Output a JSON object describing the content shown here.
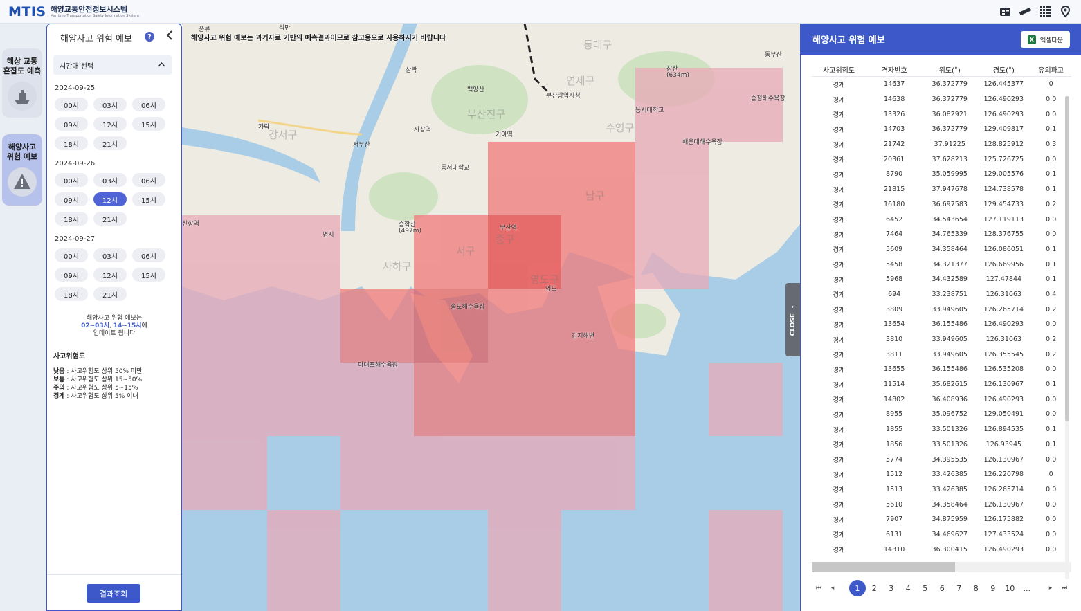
{
  "header": {
    "logo_mark": "MTIS",
    "logo_ko": "해양교통안전정보시스템",
    "logo_en": "Maritime Transportation Safety Information System",
    "icons": [
      "id-card-icon",
      "ruler-icon",
      "grid-icon",
      "location-pin-icon"
    ]
  },
  "rail": {
    "items": [
      {
        "label": "해상 교통\n혼잡도 예측",
        "icon": "ship-congestion-icon"
      },
      {
        "label": "해양사고\n위험 예보",
        "icon": "ship-warning-icon"
      }
    ]
  },
  "panel": {
    "title": "해양사고 위험 예보",
    "help": "?",
    "collapse": "<",
    "time_select_label": "시간대 선택",
    "dates": [
      {
        "date": "2024-09-25",
        "slots": [
          "00시",
          "03시",
          "06시",
          "09시",
          "12시",
          "15시",
          "18시",
          "21시"
        ]
      },
      {
        "date": "2024-09-26",
        "slots": [
          "00시",
          "03시",
          "06시",
          "09시",
          "12시",
          "15시",
          "18시",
          "21시"
        ]
      },
      {
        "date": "2024-09-27",
        "slots": [
          "00시",
          "03시",
          "06시",
          "09시",
          "12시",
          "15시",
          "18시",
          "21시"
        ]
      }
    ],
    "selected": {
      "date": "2024-09-26",
      "slot": "12시"
    },
    "note_line1": "해양사고 위험 예보는",
    "note_time1": "02~03시",
    "note_sep": ", ",
    "note_time2": "14~15시",
    "note_suffix": "에",
    "note_line3": "업데이트 됩니다",
    "legend_title": "사고위험도",
    "legend": [
      {
        "level": "낮음",
        "desc": " : 사고위험도 상위 50% 미만"
      },
      {
        "level": "보통",
        "desc": " : 사고위험도 상위 15~50%"
      },
      {
        "level": "주의",
        "desc": " : 사고위험도 상위 5~15%"
      },
      {
        "level": "경계",
        "desc": " : 사고위험도 상위 5% 이내"
      }
    ],
    "search_button": "결과조회"
  },
  "map": {
    "notice": "해양사고 위험 예보는 과거자료 기반의 예측결과이므로 참고용으로 사용하시기 바랍니다",
    "close_tab": "CLOSE",
    "labels": [
      "풍류",
      "식만",
      "강서구",
      "가락",
      "서부산",
      "삼락",
      "백양산",
      "부산진구",
      "사상역",
      "기아역",
      "동서대학교",
      "동래구",
      "부산광역시청",
      "연제구",
      "수영구",
      "동서대학교",
      "해운대해수욕장",
      "송정해수욕장",
      "장산",
      "(634m)",
      "동부산",
      "신항역",
      "명지",
      "승학산",
      "(497m)",
      "사하구",
      "서구",
      "중구",
      "부산역",
      "남구",
      "영도구",
      "영도",
      "송도해수욕장",
      "감지해변",
      "다대포해수욕장"
    ]
  },
  "result": {
    "title": "해양사고 위험 예보",
    "excel_button": "엑셀다운",
    "columns": [
      "사고위험도",
      "격자번호",
      "위도(˚)",
      "경도(˚)",
      "유의파고"
    ],
    "rows": [
      [
        "경계",
        "14637",
        "36.372779",
        "126.445377",
        "0"
      ],
      [
        "경계",
        "14638",
        "36.372779",
        "126.490293",
        "0.0"
      ],
      [
        "경계",
        "13326",
        "36.082921",
        "126.490293",
        "0.0"
      ],
      [
        "경계",
        "14703",
        "36.372779",
        "129.409817",
        "0.1"
      ],
      [
        "경계",
        "21742",
        "37.91225",
        "128.825912",
        "0.3"
      ],
      [
        "경계",
        "20361",
        "37.628213",
        "125.726725",
        "0.0"
      ],
      [
        "경계",
        "8790",
        "35.059995",
        "129.005576",
        "0.1"
      ],
      [
        "경계",
        "21815",
        "37.947678",
        "124.738578",
        "0.1"
      ],
      [
        "경계",
        "16180",
        "36.697583",
        "129.454733",
        "0.2"
      ],
      [
        "경계",
        "6452",
        "34.543654",
        "127.119113",
        "0.0"
      ],
      [
        "경계",
        "7464",
        "34.765339",
        "128.376755",
        "0.0"
      ],
      [
        "경계",
        "5609",
        "34.358464",
        "126.086051",
        "0.1"
      ],
      [
        "경계",
        "5458",
        "34.321377",
        "126.669956",
        "0.1"
      ],
      [
        "경계",
        "5968",
        "34.432589",
        "127.47844",
        "0.1"
      ],
      [
        "경계",
        "694",
        "33.238751",
        "126.31063",
        "0.4"
      ],
      [
        "경계",
        "3809",
        "33.949605",
        "126.265714",
        "0.2"
      ],
      [
        "경계",
        "13654",
        "36.155486",
        "126.490293",
        "0.0"
      ],
      [
        "경계",
        "3810",
        "33.949605",
        "126.31063",
        "0.2"
      ],
      [
        "경계",
        "3811",
        "33.949605",
        "126.355545",
        "0.2"
      ],
      [
        "경계",
        "13655",
        "36.155486",
        "126.535208",
        "0.0"
      ],
      [
        "경계",
        "11514",
        "35.682615",
        "126.130967",
        "0.1"
      ],
      [
        "경계",
        "14802",
        "36.408936",
        "126.490293",
        "0.0"
      ],
      [
        "경계",
        "8955",
        "35.096752",
        "129.050491",
        "0.0"
      ],
      [
        "경계",
        "1855",
        "33.501326",
        "126.894535",
        "0.1"
      ],
      [
        "경계",
        "1856",
        "33.501326",
        "126.93945",
        "0.1"
      ],
      [
        "경계",
        "5774",
        "34.395535",
        "126.130967",
        "0.0"
      ],
      [
        "경계",
        "1512",
        "33.426385",
        "126.220798",
        "0"
      ],
      [
        "경계",
        "1513",
        "33.426385",
        "126.265714",
        "0.0"
      ],
      [
        "경계",
        "5610",
        "34.358464",
        "126.130967",
        "0.0"
      ],
      [
        "경계",
        "7907",
        "34.875959",
        "126.175882",
        "0.0"
      ],
      [
        "경계",
        "6131",
        "34.469627",
        "127.433524",
        "0.0"
      ],
      [
        "경계",
        "14310",
        "36.300415",
        "126.490293",
        "0.0"
      ]
    ],
    "pager": {
      "first": "⏮",
      "prev": "◂",
      "pages": [
        "1",
        "2",
        "3",
        "4",
        "5",
        "6",
        "7",
        "8",
        "9",
        "10",
        "..."
      ],
      "current": "1",
      "next": "▸",
      "last": "⏭"
    }
  }
}
